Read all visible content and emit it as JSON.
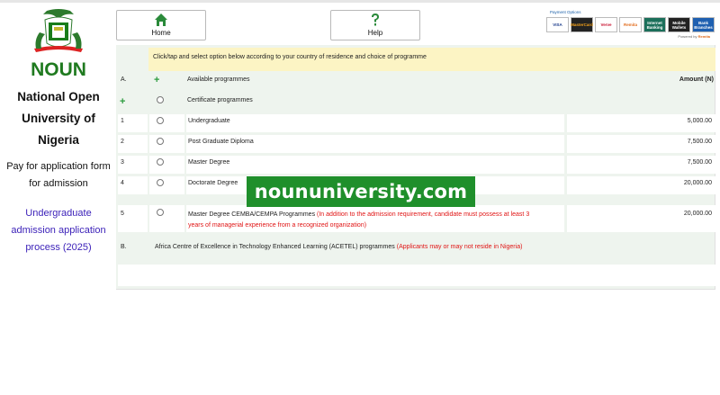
{
  "sidebar": {
    "logo_text": "NOUN",
    "org_name_line1": "National Open",
    "org_name_line2": "University of",
    "org_name_line3": "Nigeria",
    "pay_line1": "Pay for application form",
    "pay_line2": "for admission",
    "process_line1": "Undergraduate",
    "process_line2": "admission application",
    "process_line3": "process (2025)"
  },
  "nav": {
    "home_label": "Home",
    "help_label": "Help"
  },
  "payment": {
    "title": "Payment Options",
    "logos": [
      "VISA",
      "MasterCard",
      "Verve",
      "Remita",
      "Internet Banking",
      "Mobile Wallets",
      "Bank Branches"
    ],
    "powered_by": "Powered by",
    "powered_brand": "Remita"
  },
  "form": {
    "instruction": "Click/tap and select option below according to your country of residence and choice of programme",
    "section_a_letter": "A.",
    "section_a_title": "Available programmes",
    "amount_header": "Amount (N)",
    "certificate_label": "Certificate programmes",
    "programmes": [
      {
        "num": "1",
        "name": "Undergraduate",
        "amount": "5,000.00"
      },
      {
        "num": "2",
        "name": "Post Graduate Diploma",
        "amount": "7,500.00"
      },
      {
        "num": "3",
        "name": "Master Degree",
        "amount": "7,500.00"
      },
      {
        "num": "4",
        "name": "Doctorate Degree",
        "amount": "20,000.00"
      }
    ],
    "row5": {
      "num": "5",
      "name": "Master Degree CEMBA/CEMPA Programmes",
      "note_line1": "(In addition to the admission requirement, candidate must possess at least 3",
      "note_line2": "years of managerial experience from a recognized organization)",
      "amount": "20,000.00"
    },
    "section_b_letter": "B.",
    "section_b_title": "Africa Centre of Excellence in Technology Enhanced Learning (ACETEL) programmes",
    "section_b_note": "(Applicants may or may not reside in Nigeria)"
  },
  "watermark": "noununiversity.com"
}
